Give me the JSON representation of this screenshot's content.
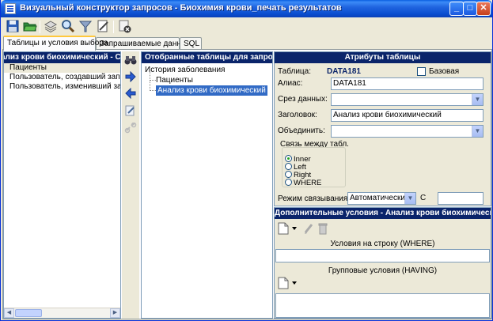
{
  "window": {
    "title": "Визуальный конструктор запросов - Биохимия крови_печать результатов",
    "minimize": "_",
    "maximize": "□",
    "close": "✕"
  },
  "toolbar": {
    "icons": [
      "save-icon",
      "open-folder-icon",
      "layers-icon",
      "search-icon",
      "filter-icon",
      "edit-document-icon",
      "close-query-icon"
    ]
  },
  "tabs": [
    {
      "label": "Таблицы и условия выбора",
      "active": true
    },
    {
      "label": "Запрашиваемые данные",
      "active": false
    },
    {
      "label": "SQL",
      "active": false
    }
  ],
  "left_pane": {
    "header": "ализ крови биохимический - Свя",
    "fields": [
      "Пациенты",
      "Пользователь, создавший запись (Е",
      "Пользователь, изменивший запись"
    ]
  },
  "middle_buttons": [
    "binoculars-icon",
    "arrow-right-icon",
    "arrow-left-icon",
    "edit-link-icon",
    "link-icon"
  ],
  "selected_tables": {
    "header": "Отобранные таблицы для запроса",
    "root": "История заболевания",
    "children": [
      "Пациенты",
      "Анализ крови биохимический"
    ]
  },
  "attributes": {
    "header": "Атрибуты таблицы",
    "table_label": "Таблица:",
    "table_value": "DATA181",
    "base_label": "Базовая",
    "base_checked": false,
    "alias_label": "Алиас:",
    "alias_value": "DATA181",
    "slice_label": "Срез данных:",
    "slice_value": "",
    "title_label": "Заголовок:",
    "title_value": "Анализ крови биохимический",
    "merge_label": "Объединить:",
    "merge_value": "",
    "link_group_label": "Связь между табл.",
    "link_options": [
      "Inner",
      "Left",
      "Right",
      "WHERE"
    ],
    "link_selected": "Inner",
    "mode_label": "Режим связывания:",
    "mode_value": "Автоматически",
    "c_label": "С",
    "c_value": ""
  },
  "conditions": {
    "header": "Дополнительные условия - Анализ крови биохимический",
    "where_label": "Условия на строку (WHERE)",
    "having_label": "Групповые условия (HAVING)"
  },
  "colors": {
    "titlebar": "#2165E0",
    "pane_header": "#0a246a",
    "selection": "#316ac5",
    "window_bg": "#ECE9D8"
  }
}
